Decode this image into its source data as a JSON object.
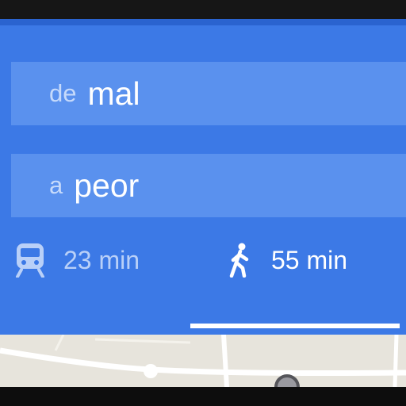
{
  "directions": {
    "from_prefix": "de",
    "from_value": "mal",
    "to_prefix": "a",
    "to_value": "peor"
  },
  "modes": {
    "transit": {
      "icon": "train-icon",
      "time": "23 min",
      "selected": false
    },
    "walk": {
      "icon": "walking-person-icon",
      "time": "55 min",
      "selected": true
    }
  },
  "colors": {
    "panel_blue": "#3c79e6",
    "field_blue": "#5a91ee",
    "map_background": "#e7e4dc"
  }
}
